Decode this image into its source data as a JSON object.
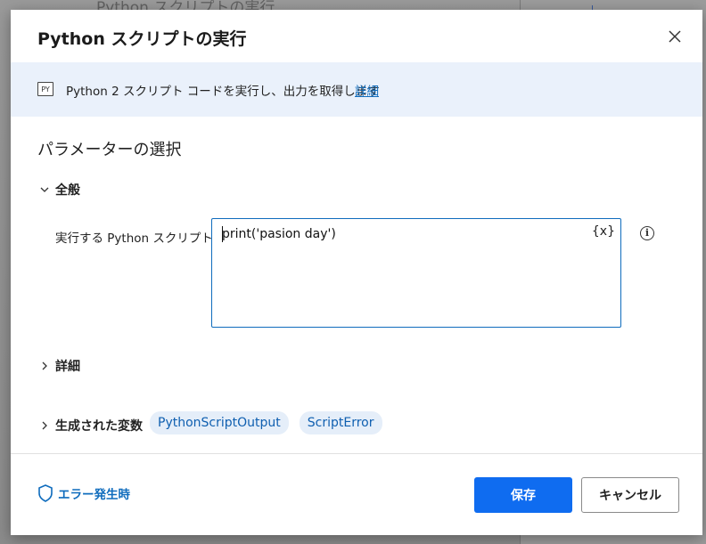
{
  "background": {
    "title": "Python スクリプトの実行"
  },
  "dialog": {
    "title": "Python スクリプトの実行",
    "close_icon": "close-icon",
    "banner": {
      "icon_label": "PY",
      "text": "Python 2 スクリプト コードを実行し、出力を取得します",
      "link": "詳細"
    },
    "section_title": "パラメーターの選択",
    "general": {
      "label": "全般",
      "expanded": true,
      "script_label": "実行する Python スクリプト:",
      "script_value": "print('pasion day')",
      "var_button": "{x}",
      "info_icon": "i"
    },
    "advanced": {
      "label": "詳細",
      "expanded": false
    },
    "variables": {
      "label": "生成された変数",
      "expanded": false,
      "items": [
        "PythonScriptOutput",
        "ScriptError"
      ]
    },
    "footer": {
      "on_error": "エラー発生時",
      "save": "保存",
      "cancel": "キャンセル"
    }
  },
  "colors": {
    "accent": "#0f6cf0",
    "link": "#0f6cbd",
    "banner_bg": "#eaf1fb",
    "chip_bg": "#e5eef9"
  }
}
